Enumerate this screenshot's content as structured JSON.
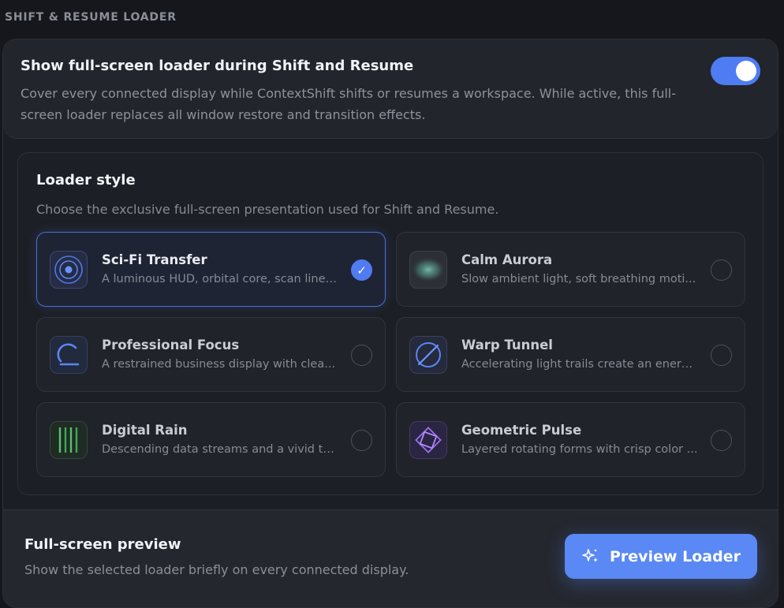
{
  "section": {
    "title": "SHIFT & RESUME LOADER"
  },
  "toggle": {
    "title": "Show full-screen loader during Shift and Resume",
    "description": "Cover every connected display while ContextShift shifts or resumes a workspace. While active, this full-screen loader replaces all window restore and transition effects.",
    "enabled": true
  },
  "loader_style": {
    "title": "Loader style",
    "subtitle": "Choose the exclusive full-screen presentation used for Shift and Resume.",
    "options": [
      {
        "name": "Sci-Fi Transfer",
        "description": "A luminous HUD, orbital core, scan lines,...",
        "icon": "orbital-target-icon",
        "selected": true
      },
      {
        "name": "Calm Aurora",
        "description": "Slow ambient light, soft breathing moti...",
        "icon": "aurora-glow-icon",
        "selected": false
      },
      {
        "name": "Professional Focus",
        "description": "A restrained business display with clea...",
        "icon": "focus-arc-icon",
        "selected": false
      },
      {
        "name": "Warp Tunnel",
        "description": "Accelerating light trails create an energ...",
        "icon": "warp-tunnel-icon",
        "selected": false
      },
      {
        "name": "Digital Rain",
        "description": "Descending data streams and a vivid te...",
        "icon": "digital-rain-icon",
        "selected": false
      },
      {
        "name": "Geometric Pulse",
        "description": "Layered rotating forms with crisp color ...",
        "icon": "geometric-pulse-icon",
        "selected": false
      }
    ]
  },
  "preview": {
    "title": "Full-screen preview",
    "description": "Show the selected loader briefly on every connected display.",
    "button_label": "Preview Loader",
    "button_icon": "sparkles-icon"
  },
  "colors": {
    "accent": "#4f7cf3",
    "button": "#5a88f4",
    "background": "#15171c"
  }
}
